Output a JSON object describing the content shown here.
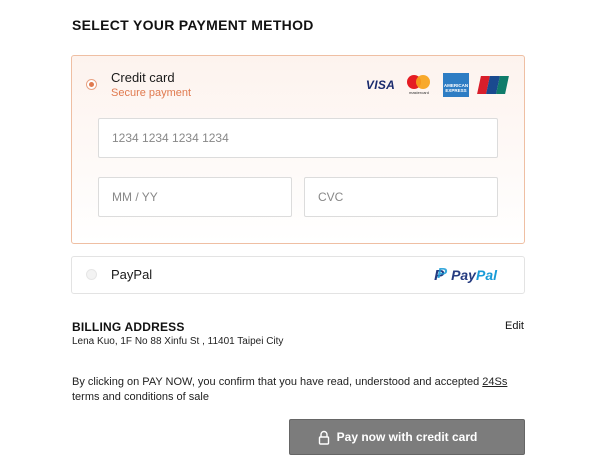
{
  "page": {
    "title": "SELECT YOUR PAYMENT METHOD"
  },
  "credit_card": {
    "label": "Credit card",
    "subtitle": "Secure payment",
    "brands": {
      "visa": "VISA",
      "mastercard_text": "mastercard",
      "amex_text": "AMERICAN EXPRESS"
    },
    "card_number_placeholder": "1234 1234 1234 1234",
    "expiry_placeholder": "MM / YY",
    "cvc_placeholder": "CVC"
  },
  "paypal": {
    "label": "PayPal",
    "logo_part1": "Pay",
    "logo_part2": "Pal",
    "logo_mark": "P"
  },
  "billing": {
    "title": "BILLING ADDRESS",
    "address": "Lena Kuo, 1F No 88 Xinfu St , 11401 Taipei City",
    "edit_label": "Edit"
  },
  "terms": {
    "text_before": "By clicking on PAY NOW, you confirm that you have read, understood and accepted ",
    "link_text": "24Ss",
    "text_after": " terms and conditions of sale"
  },
  "pay_button": {
    "label": "Pay now with credit card"
  },
  "colors": {
    "accent": "#e07a4f",
    "selected_border": "#efbfa3",
    "button_bg": "#7c7c7c",
    "paypal_dark": "#253b80",
    "paypal_light": "#179bd7"
  },
  "icons": [
    "radio-selected-icon",
    "visa-logo",
    "mastercard-logo",
    "amex-logo",
    "unionpay-logo",
    "radio-unselected-icon",
    "paypal-logo",
    "lock-icon"
  ]
}
